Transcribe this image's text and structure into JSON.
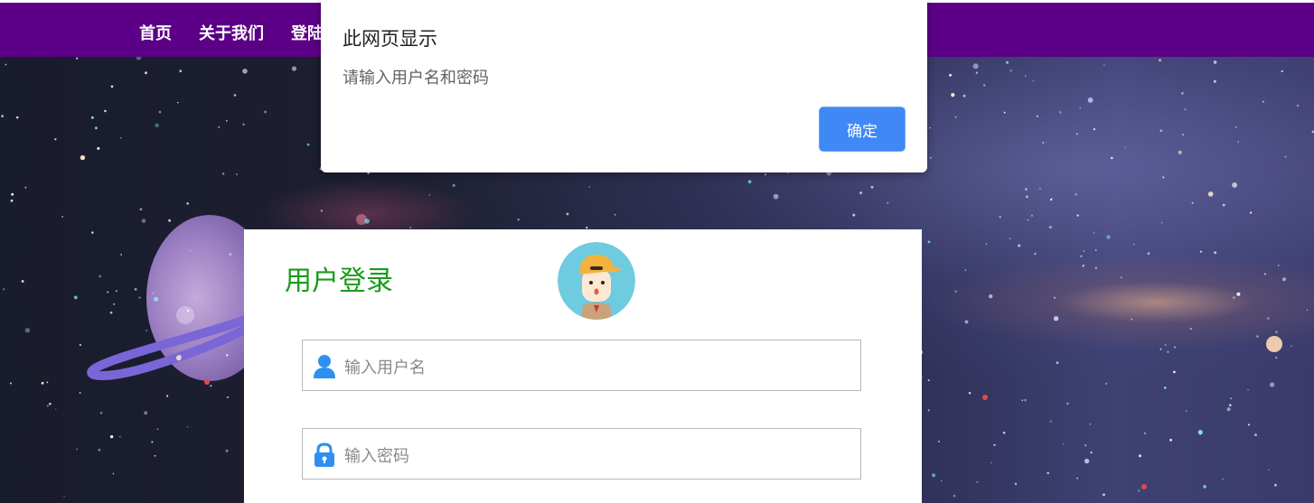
{
  "nav": {
    "items": [
      {
        "label": "首页"
      },
      {
        "label": "关于我们"
      },
      {
        "label": "登陆"
      }
    ]
  },
  "dialog": {
    "title": "此网页显示",
    "message": "请输入用户名和密码",
    "ok_label": "确定"
  },
  "login": {
    "title": "用户登录",
    "username_placeholder": "输入用户名",
    "password_placeholder": "输入密码"
  },
  "colors": {
    "navbar": "#5c0087",
    "title_green": "#1a9a1a",
    "dialog_button": "#3f88f5",
    "icon_blue": "#2d8ff0"
  },
  "icons": [
    "user-icon",
    "lock-icon",
    "avatar-icon"
  ]
}
